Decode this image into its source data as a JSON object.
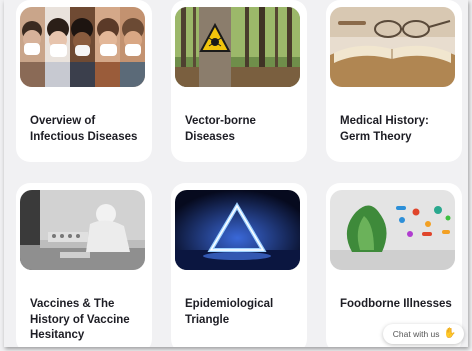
{
  "cards": [
    {
      "title": "Overview of Infectious Diseases",
      "image": "people-sneezing-image"
    },
    {
      "title": "Vector-borne Diseases",
      "image": "tick-warning-forest-image"
    },
    {
      "title": "Medical History: Germ Theory",
      "image": "old-book-eyeglasses-image"
    },
    {
      "title": "Vaccines & The History of Vaccine Hesitancy",
      "image": "vintage-lab-worker-image"
    },
    {
      "title": "Epidemiological Triangle",
      "image": "neon-triangle-image"
    },
    {
      "title": "Foodborne Illnesses",
      "image": "lettuce-bacteria-image"
    }
  ],
  "chat_widget": {
    "label": "Chat with us",
    "icon": "wave-hand-icon"
  }
}
